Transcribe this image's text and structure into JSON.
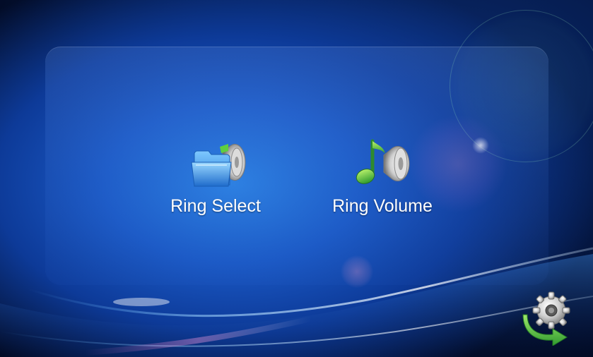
{
  "menu": {
    "items": [
      {
        "label": "Ring Select",
        "icon": "folder-speaker-icon"
      },
      {
        "label": "Ring Volume",
        "icon": "music-speaker-icon"
      }
    ]
  },
  "corner_button": {
    "icon": "gear-back-arrow-icon"
  },
  "colors": {
    "background_blue": "#1a58c4",
    "label_text": "#ffffff",
    "arrow_green": "#3cb33c",
    "gear_gray": "#c8c8c8"
  }
}
